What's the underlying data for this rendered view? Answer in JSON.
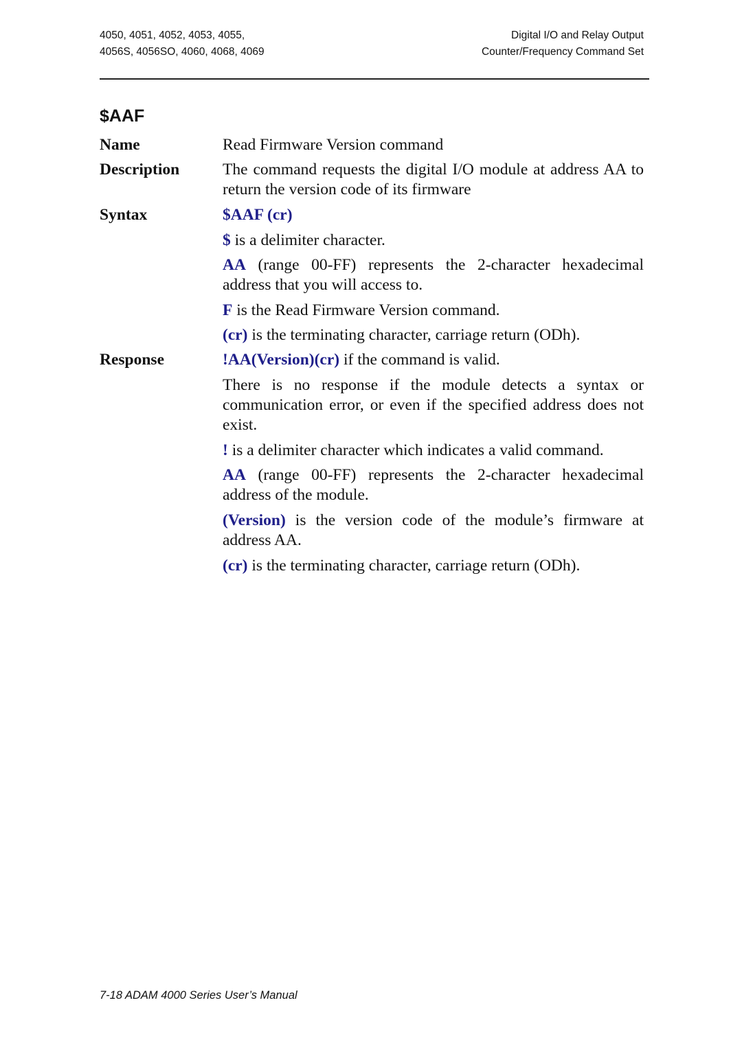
{
  "header": {
    "left_line1": "4050, 4051, 4052, 4053, 4055,",
    "left_line2": "4056S, 4056SO, 4060, 4068, 4069",
    "right_line1": "Digital I/O and Relay Output",
    "right_line2": "Counter/Frequency Command Set"
  },
  "command": {
    "title": "$AAF",
    "name_label": "Name",
    "name_value": "Read Firmware Version command",
    "description_label": "Description",
    "description_value": "The command requests the digital I/O module at address AA to return the version code of its firmware",
    "syntax_label": "Syntax",
    "syntax_value": "$AAF (cr)",
    "syntax_items": [
      {
        "term": "$",
        "text": " is a delimiter character."
      },
      {
        "term": "AA",
        "text": " (range 00-FF) represents the 2-character hexadecimal address that you will access to."
      },
      {
        "term": "F",
        "text": " is the Read Firmware Version command."
      },
      {
        "term": "(cr)",
        "text": " is the terminating character, carriage return (ODh)."
      }
    ],
    "response_label": "Response",
    "response_value_term": "!AA(Version)(cr)",
    "response_value_text": " if the command is valid.",
    "response_note": "There is no response if the module detects a syntax or communication error, or even if the specified address does not exist.",
    "response_items": [
      {
        "term": "!",
        "text": " is a delimiter character which indicates a valid command."
      },
      {
        "term": "AA",
        "text": " (range 00-FF) represents the 2-character hexadecimal address of the module."
      },
      {
        "term": "(Version)",
        "text": " is the version code of the module’s firmware at address AA."
      },
      {
        "term": "(cr)",
        "text": " is the terminating character, carriage return (ODh)."
      }
    ]
  },
  "footer": {
    "text": "7-18 ADAM 4000 Series User’s Manual"
  },
  "colors": {
    "accent_blue": "#1f1f8a"
  }
}
